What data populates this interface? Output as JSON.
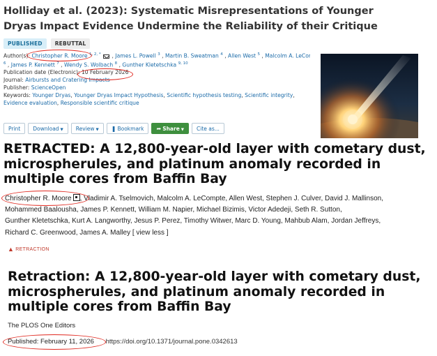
{
  "scienceopen": {
    "title": "Holliday et al. (2023): Systematic Misrepresentations of Younger Dryas Impact Evidence Undermine the Reliability of their Critique",
    "badges": {
      "published": "PUBLISHED",
      "rebuttal": "REBUTTAL"
    },
    "authors": {
      "prefix": "Author(s):",
      "list": [
        {
          "name": "Christopher R. Moore",
          "sup": "1, 2, *"
        },
        {
          "name": "James L. Powell",
          "sup": "3"
        },
        {
          "name": "Martin B. Sweatman",
          "sup": "4"
        },
        {
          "name": "Allen West",
          "sup": "5"
        },
        {
          "name": "Malcolm A. LeCompte",
          "sup": "6"
        },
        {
          "name": "James P. Kennett",
          "sup": "7"
        },
        {
          "name": "Wendy S. Wolbach",
          "sup": "8"
        },
        {
          "name": "Gunther Kletetschka",
          "sup": "9, 10"
        }
      ]
    },
    "publication_date": {
      "label": "Publication date (Electronic):",
      "value": "10 February 2026"
    },
    "journal": {
      "label": "Journal:",
      "value": "Airbursts and Cratering Impacts"
    },
    "publisher": {
      "label": "Publisher:",
      "value": "ScienceOpen"
    },
    "keywords": {
      "label": "Keywords:",
      "list": [
        "Younger Dryas",
        "Younger Dryas Impact Hypothesis",
        "Scientific hypothesis testing",
        "Scientific integrity",
        "Evidence evaluation",
        "Responsible scientific critique"
      ]
    },
    "toolbar": {
      "print": "Print",
      "download": "Download",
      "review": "Review",
      "bookmark": "Bookmark",
      "share": "Share",
      "cite": "Cite as..."
    },
    "cover_image_icon": "comet-impact-illustration"
  },
  "plos_article": {
    "title": "RETRACTED: A 12,800-year-old layer with cometary dust, microspherules, and platinum anomaly recorded in multiple cores from Baffin Bay",
    "authors": [
      "Christopher R. Moore",
      "Vladimir A. Tselmovich, Malcolm A. LeCompte, Allen West, Stephen J. Culver, David J. Mallinson,",
      "Mohammed Baalousha, James P. Kennett, William M. Napier, Michael Bizimis, Victor Adedeji, Seth R. Sutton,",
      "Gunther Kletetschka, Kurt A. Langworthy, Jesus P. Perez, Timothy Witwer, Marc D. Young, Mahbub Alam, Jordan Jeffreys,",
      "Richard C. Greenwood, James A. Malley"
    ],
    "view_less": "[ view less ]",
    "retraction_tag": "RETRACTION"
  },
  "plos_notice": {
    "title": "Retraction: A 12,800-year-old layer with cometary dust, microspherules, and platinum anomaly recorded in multiple cores from Baffin Bay",
    "editors": "The PLOS One Editors",
    "published": "Published: February 11, 2026",
    "doi": "https://doi.org/10.1371/journal.pone.0342613"
  },
  "colors": {
    "link": "#1a6aa8",
    "share_green": "#3e8f3e",
    "retraction_red": "#c0392b",
    "annotation_red": "#e0281f"
  }
}
